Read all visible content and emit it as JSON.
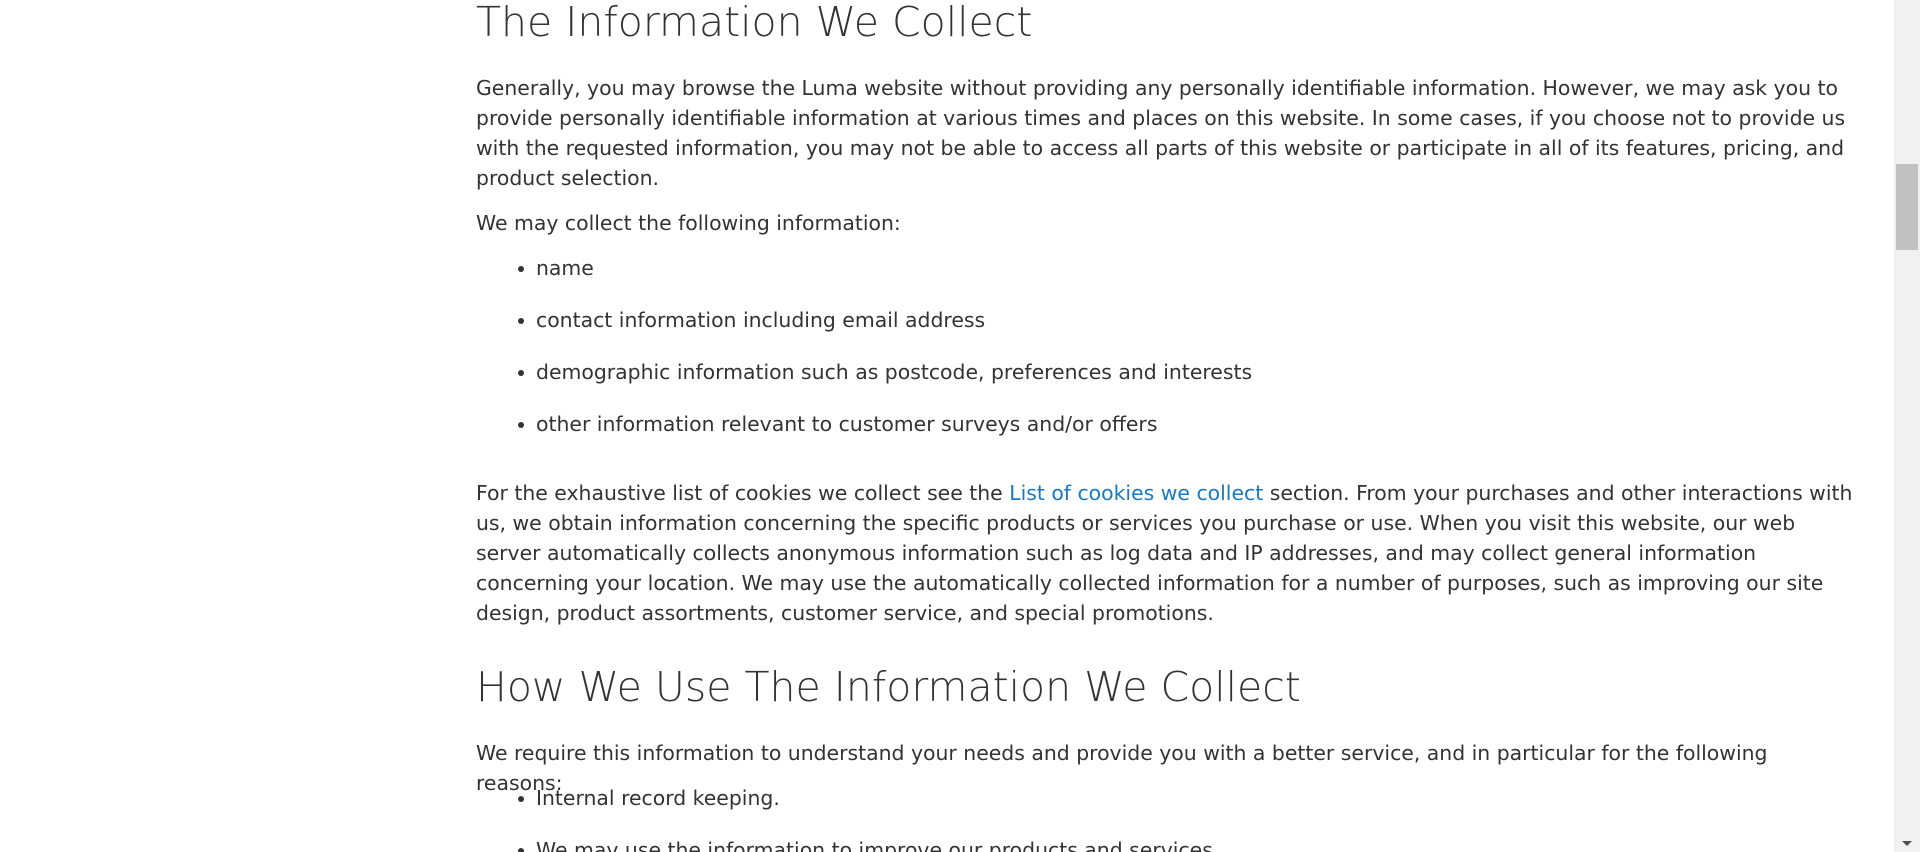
{
  "section1": {
    "heading": "The Information We Collect",
    "intro": "Generally, you may browse the Luma website without providing any personally identifiable information. However, we may ask you to provide personally identifiable information at various times and places on this website. In some cases, if you choose not to provide us with the requested information, you may not be able to access all parts of this website or participate in all of its features, pricing, and product selection.",
    "list_intro": "We may collect the following information:",
    "items": [
      "name",
      "contact information including email address",
      "demographic information such as postcode, preferences and interests",
      "other information relevant to customer surveys and/or offers"
    ],
    "cookies_text_before": "For the exhaustive list of cookies we collect see the ",
    "cookies_link": "List of cookies we collect",
    "cookies_text_after": " section. From your purchases and other interactions with us, we obtain information concerning the specific products or services you purchase or use. When you visit this website, our web server automatically collects anonymous information such as log data and IP addresses, and may collect general information concerning your location. We may use the automatically collected information for a number of purposes, such as improving our site design, product assortments, customer service, and special promotions."
  },
  "section2": {
    "heading": "How We Use The Information We Collect",
    "intro": "We require this information to understand your needs and provide you with a better service, and in particular for the following reasons:",
    "items": [
      "Internal record keeping.",
      "We may use the information to improve our products and services."
    ]
  },
  "colors": {
    "text": "#333333",
    "link": "#1979c3",
    "scrollbar_track": "#f1f1f1",
    "scrollbar_thumb": "#c1c1c1"
  }
}
